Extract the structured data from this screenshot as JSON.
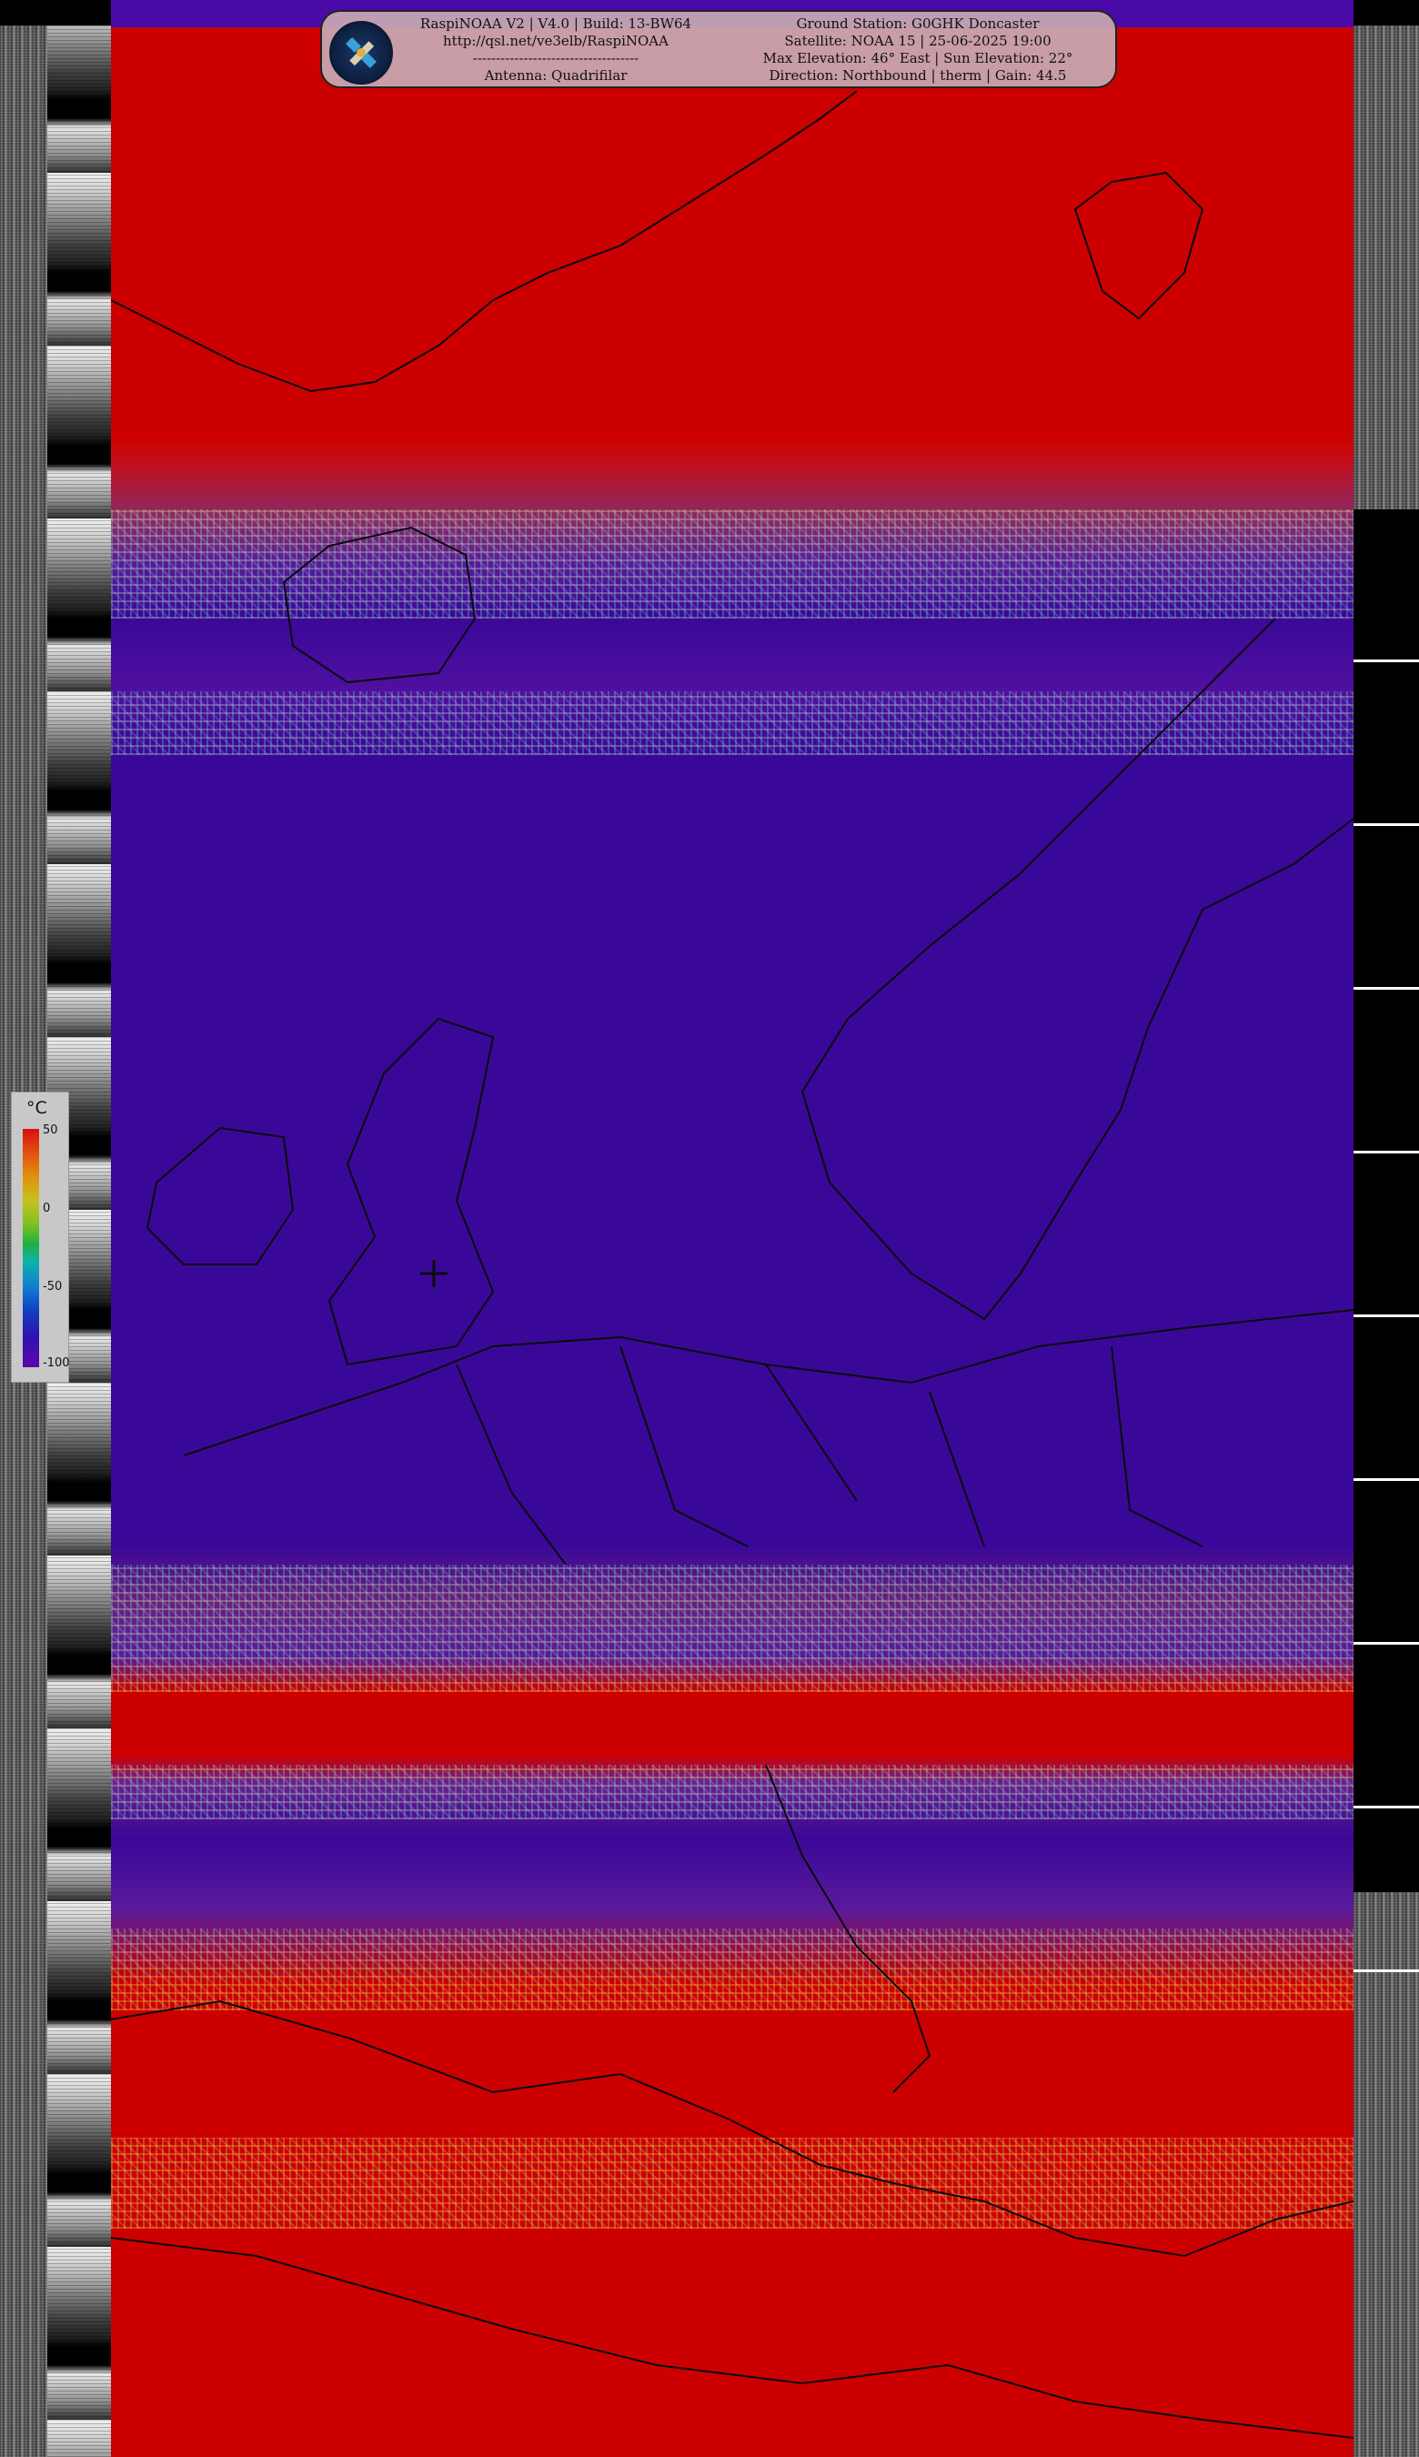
{
  "header": {
    "left_lines": [
      "RaspiNOAA V2 | V4.0 | Build: 13-BW64",
      "http://qsl.net/ve3elb/RaspiNOAA",
      "------------------------------------",
      "Antenna: Quadrifilar"
    ],
    "right_lines": [
      "Ground Station: G0GHK Doncaster",
      "Satellite: NOAA 15 | 25-06-2025 19:00",
      "Max Elevation: 46° East | Sun Elevation: 22°",
      "Direction: Northbound | therm | Gain: 44.5"
    ]
  },
  "legend": {
    "unit": "°C",
    "ticks": [
      "50",
      "0",
      "-50",
      "-100"
    ]
  },
  "colors": {
    "warm": "#cc0000",
    "cold": "#3a0898",
    "panel": "#c8aab4"
  }
}
